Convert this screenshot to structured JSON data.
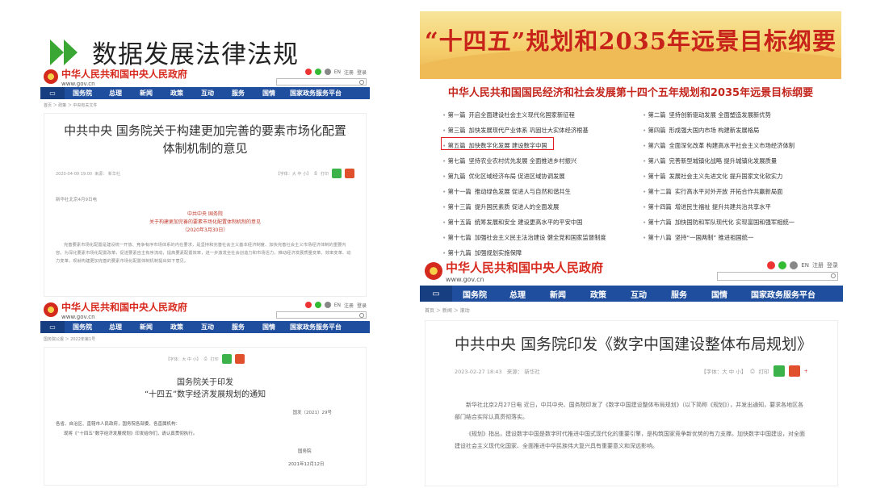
{
  "slide": {
    "title": "数据发展法律法规"
  },
  "gov": {
    "name": "中华人民共和国中央人民政府",
    "url": "www.gov.cn",
    "tools_a": "EN",
    "tools_b": "注册",
    "tools_c": "登录",
    "nav": [
      "国务院",
      "总理",
      "新闻",
      "政策",
      "互动",
      "服务",
      "国情",
      "国家政务服务平台"
    ]
  },
  "doc1": {
    "crumb": "首页 ＞ 政策 ＞ 中央有关文件",
    "title_line1": "中共中央 国务院关于构建更加完善的要素市场化配置",
    "title_line2": "体制机制的意见",
    "date": "2020-04-09 19:00",
    "source": "来源： 新华社",
    "fontsize": "【字体：大 中 小】",
    "print": "打印",
    "dateline": "新华社北京4月9日电",
    "red1": "中共中央 国务院",
    "red2": "关于构建更加完善的要素市场化配置体制机制的意见",
    "red3": "（2020年3月30日）",
    "para1": "完善要素市场化配置是建设统一开放、竞争有序市场体系的内在要求，是坚持和完善社会主义基本经济制度、加快完善社会主义市场经济体制的重要内容。为深化要素市场化配置改革，促进要素自主有序流动，提高要素配置效率，进一步激发全社会创造力和市场活力，推动经济发展质量变革、效率变革、动力变革，现就构建更加完善的要素市场化配置体制机制提出如下意见。"
  },
  "doc2": {
    "crumb": "国务院公报 ＞ 2022年第1号",
    "fontsize": "【字体：大 中 小】",
    "print": "打印",
    "title_line1": "国务院关于印发",
    "title_line2": "“十四五”数字经济发展规划的通知",
    "docno": "国发〔2021〕29号",
    "recipients": "各省、自治区、直辖市人民政府，国务院各部委、各直属机构：",
    "body": "现将《“十四五”数字经济发展规划》印发给你们，请认真贯彻执行。",
    "sign": "国务院",
    "date": "2021年12月12日"
  },
  "plan": {
    "banner": "“十四五”规划和2035年远景目标纲要",
    "title": "中华人民共和国国民经济和社会发展第十四个五年规划和2035年远景目标纲要",
    "left": [
      {
        "num": "第一篇",
        "text": "开启全面建设社会主义现代化国家新征程"
      },
      {
        "num": "第三篇",
        "text": "加快发展现代产业体系  巩固壮大实体经济根基"
      },
      {
        "num": "第五篇",
        "text": "加快数字化发展  建设数字中国"
      },
      {
        "num": "第七篇",
        "text": "坚持农业农村优先发展  全面推进乡村振兴"
      },
      {
        "num": "第九篇",
        "text": "优化区域经济布局  促进区域协调发展"
      },
      {
        "num": "第十一篇",
        "text": "推动绿色发展  促进人与自然和谐共生"
      },
      {
        "num": "第十三篇",
        "text": "提升国民素质  促进人的全面发展"
      },
      {
        "num": "第十五篇",
        "text": "统筹发展和安全  建设更高水平的平安中国"
      },
      {
        "num": "第十七篇",
        "text": "加强社会主义民主法治建设  健全党和国家监督制度"
      },
      {
        "num": "第十九篇",
        "text": "加强规划实施保障"
      }
    ],
    "right": [
      {
        "num": "第二篇",
        "text": "坚持创新驱动发展  全面塑造发展新优势"
      },
      {
        "num": "第四篇",
        "text": "形成强大国内市场  构建新发展格局"
      },
      {
        "num": "第六篇",
        "text": "全面深化改革  构建高水平社会主义市场经济体制"
      },
      {
        "num": "第八篇",
        "text": "完善新型城镇化战略  提升城镇化发展质量"
      },
      {
        "num": "第十篇",
        "text": "发展社会主义先进文化  提升国家文化软实力"
      },
      {
        "num": "第十二篇",
        "text": "实行高水平对外开放  开拓合作共赢新局面"
      },
      {
        "num": "第十四篇",
        "text": "增进民生福祉  提升共建共治共享水平"
      },
      {
        "num": "第十六篇",
        "text": "加快国防和军队现代化  实现富国和强军相统一"
      },
      {
        "num": "第十八篇",
        "text": "坚持“一国两制”  推进祖国统一"
      }
    ]
  },
  "doc3": {
    "crumb": "首页 ＞ 新闻 ＞ 滚动",
    "title": "中共中央 国务院印发《数字中国建设整体布局规划》",
    "date": "2023-02-27 18:43",
    "source": "来源： 新华社",
    "fontsize": "【字体：大 中 小】",
    "print": "打印",
    "para1": "新华社北京2月27日电 近日，中共中央、国务院印发了《数字中国建设整体布局规划》（以下简称《规划》），并发出通知，要求各地区各部门结合实际认真贯彻落实。",
    "para2": "《规划》指出，建设数字中国是数字时代推进中国式现代化的重要引擎，是构筑国家竞争新优势的有力支撑。加快数字中国建设，对全面建设社会主义现代化国家、全面推进中华民族伟大复兴具有重要意义和深远影响。"
  }
}
